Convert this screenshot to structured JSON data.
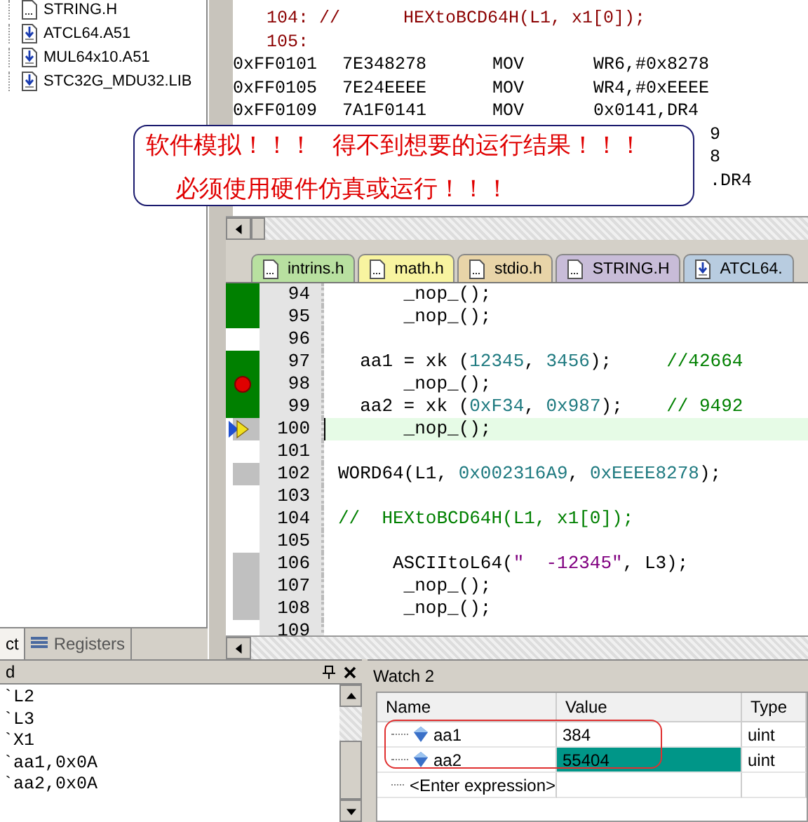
{
  "project_tree": {
    "items": [
      {
        "label": "STRING.H",
        "kind": "header"
      },
      {
        "label": "ATCL64.A51",
        "kind": "asm"
      },
      {
        "label": "MUL64x10.A51",
        "kind": "asm"
      },
      {
        "label": "STC32G_MDU32.LIB",
        "kind": "asm"
      }
    ]
  },
  "left_tabs": [
    {
      "label": "ct",
      "selected": true,
      "kind": "plain"
    },
    {
      "label": "Registers",
      "selected": false,
      "kind": "registers"
    }
  ],
  "disassembly": {
    "lines": [
      {
        "kind": "source",
        "text": "104: //      HEXtoBCD64H(L1, x1[0]);"
      },
      {
        "kind": "source",
        "text": "105:"
      },
      {
        "kind": "asm",
        "address": "0xFF0101",
        "opcode": "7E348278",
        "mnemonic": "MOV",
        "operand": "WR6,#0x8278"
      },
      {
        "kind": "asm",
        "address": "0xFF0105",
        "opcode": "7E24EEEE",
        "mnemonic": "MOV",
        "operand": "WR4,#0xEEEE"
      },
      {
        "kind": "asm",
        "address": "0xFF0109",
        "opcode": "7A1F0141",
        "mnemonic": "MOV",
        "operand": "0x0141,DR4"
      },
      {
        "kind": "tail",
        "text": "9"
      },
      {
        "kind": "tail",
        "text": "8"
      },
      {
        "kind": "tail",
        "text": ".DR4"
      }
    ]
  },
  "callout": {
    "lines": [
      "软件模拟！！！   得不到想要的运行结果！！！",
      "必须使用硬件仿真或运行！！！"
    ]
  },
  "editor_tabs": [
    {
      "label": "intrins.h",
      "kind": "header",
      "color": "#b8e0a0",
      "selected": false
    },
    {
      "label": "math.h",
      "kind": "header",
      "color": "#f8f4a0",
      "selected": false
    },
    {
      "label": "stdio.h",
      "kind": "header",
      "color": "#e8d4a8",
      "selected": false
    },
    {
      "label": "STRING.H",
      "kind": "header",
      "color": "#c8bcd8",
      "selected": false
    },
    {
      "label": "ATCL64.",
      "kind": "asm",
      "color": "#b8cce0",
      "selected": false
    }
  ],
  "code_lines": [
    {
      "number": "94",
      "kind": "executed",
      "breakpoint": false,
      "current": false,
      "segments": [
        {
          "kind": "plain",
          "text": "      _nop_();"
        }
      ]
    },
    {
      "number": "95",
      "kind": "executed",
      "breakpoint": false,
      "current": false,
      "segments": [
        {
          "kind": "plain",
          "text": "      _nop_();"
        }
      ]
    },
    {
      "number": "96",
      "kind": "plain",
      "breakpoint": false,
      "current": false
    },
    {
      "number": "97",
      "kind": "executed",
      "breakpoint": false,
      "current": false,
      "segments": [
        {
          "kind": "plain",
          "text": "  aa1 = xk ("
        },
        {
          "kind": "number",
          "text": "12345"
        },
        {
          "kind": "plain",
          "text": ", "
        },
        {
          "kind": "number",
          "text": "3456"
        },
        {
          "kind": "plain",
          "text": ");     "
        },
        {
          "kind": "comment",
          "text": "//42664"
        }
      ]
    },
    {
      "number": "98",
      "kind": "executed",
      "breakpoint": true,
      "current": false,
      "segments": [
        {
          "kind": "plain",
          "text": "      _nop_();"
        }
      ]
    },
    {
      "number": "99",
      "kind": "executed",
      "breakpoint": false,
      "current": false,
      "segments": [
        {
          "kind": "plain",
          "text": "  aa2 = xk ("
        },
        {
          "kind": "number",
          "text": "0xF34"
        },
        {
          "kind": "plain",
          "text": ", "
        },
        {
          "kind": "number",
          "text": "0x987"
        },
        {
          "kind": "plain",
          "text": ");    "
        },
        {
          "kind": "comment",
          "text": "// 9492"
        }
      ]
    },
    {
      "number": "100",
      "kind": "unexecuted",
      "breakpoint": false,
      "current": true,
      "segments": [
        {
          "kind": "plain",
          "text": "      _nop_();"
        }
      ]
    },
    {
      "number": "101",
      "kind": "plain",
      "breakpoint": false,
      "current": false
    },
    {
      "number": "102",
      "kind": "unexecuted",
      "breakpoint": false,
      "current": false,
      "segments": [
        {
          "kind": "plain",
          "text": "WORD64(L1, "
        },
        {
          "kind": "number",
          "text": "0x002316A9"
        },
        {
          "kind": "plain",
          "text": ", "
        },
        {
          "kind": "number",
          "text": "0xEEEE8278"
        },
        {
          "kind": "plain",
          "text": ");"
        }
      ]
    },
    {
      "number": "103",
      "kind": "plain",
      "breakpoint": false,
      "current": false
    },
    {
      "number": "104",
      "kind": "plain",
      "breakpoint": false,
      "current": false,
      "segments": [
        {
          "kind": "comment",
          "text": "//  HEXtoBCD64H(L1, x1[0]);"
        }
      ]
    },
    {
      "number": "105",
      "kind": "plain",
      "breakpoint": false,
      "current": false
    },
    {
      "number": "106",
      "kind": "unexecuted",
      "breakpoint": false,
      "current": false,
      "segments": [
        {
          "kind": "plain",
          "text": "     ASCIItoL64("
        },
        {
          "kind": "string",
          "text": "\"  -12345\""
        },
        {
          "kind": "plain",
          "text": ", L3);"
        }
      ]
    },
    {
      "number": "107",
      "kind": "unexecuted",
      "breakpoint": false,
      "current": false,
      "segments": [
        {
          "kind": "plain",
          "text": "      _nop_();"
        }
      ]
    },
    {
      "number": "108",
      "kind": "unexecuted",
      "breakpoint": false,
      "current": false,
      "segments": [
        {
          "kind": "plain",
          "text": "      _nop_();"
        }
      ]
    },
    {
      "number": "109",
      "kind": "plain",
      "breakpoint": false,
      "current": false
    }
  ],
  "command_panel": {
    "title": "d",
    "lines": [
      "`L2",
      "`L3",
      "`X1",
      "`aa1,0x0A",
      "`aa2,0x0A"
    ]
  },
  "watch": {
    "title": "Watch 2",
    "columns": [
      "Name",
      "Value",
      "Type"
    ],
    "rows": [
      {
        "name": "aa1",
        "value": "384",
        "type": "uint",
        "changed": false
      },
      {
        "name": "aa2",
        "value": "55404",
        "type": "uint",
        "changed": true
      }
    ],
    "placeholder": "<Enter expression>"
  }
}
